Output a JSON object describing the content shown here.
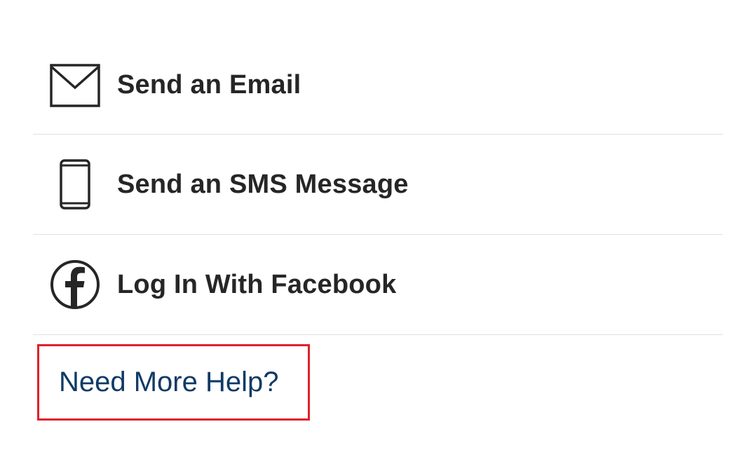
{
  "options": [
    {
      "label": "Send an Email",
      "icon": "envelope-icon"
    },
    {
      "label": "Send an SMS Message",
      "icon": "mobile-phone-icon"
    },
    {
      "label": "Log In With Facebook",
      "icon": "facebook-icon"
    }
  ],
  "help": {
    "label": "Need More Help?"
  },
  "colors": {
    "text": "#262626",
    "link": "#0f3a66",
    "highlight_border": "#e0202a",
    "divider": "#e0e0e0"
  }
}
